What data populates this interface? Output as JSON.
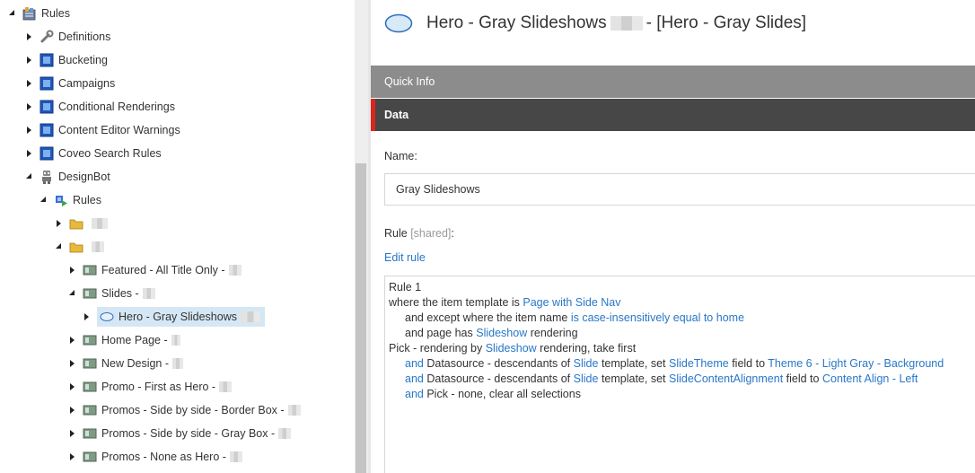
{
  "tree": {
    "rules": "Rules",
    "definitions": "Definitions",
    "bucketing": "Bucketing",
    "campaigns": "Campaigns",
    "conditional_renderings": "Conditional Renderings",
    "content_editor_warnings": "Content Editor Warnings",
    "coveo_search_rules": "Coveo Search Rules",
    "designbot": "DesignBot",
    "designbot_rules": "Rules",
    "featured": "Featured - All Title Only -",
    "slides": "Slides -",
    "hero_selected": "Hero - Gray Slideshows",
    "home_page": "Home Page -",
    "new_design": "New Design -",
    "promo_first": "Promo - First as Hero -",
    "promos_border": "Promos - Side by side - Border Box -",
    "promos_gray": "Promos - Side by side - Gray Box -",
    "promos_none": "Promos - None as Hero -"
  },
  "header": {
    "title_part1": "Hero - Gray Slideshows",
    "title_part2": "- [Hero - Gray Slides]"
  },
  "sections": {
    "quick_info": "Quick Info",
    "data": "Data"
  },
  "fields": {
    "name_label": "Name:",
    "name_value": "Gray Slideshows",
    "rule_label": "Rule",
    "rule_shared": "[shared]",
    "rule_colon": ":",
    "edit_rule": "Edit rule"
  },
  "rule": {
    "l1": "Rule 1",
    "l2a": "where the item template is",
    "l2b": "Page with Side Nav",
    "l3a": "and except where the item name",
    "l3b": "is case-insensitively equal to",
    "l3c": "home",
    "l4a": "and page has",
    "l4b": "Slideshow",
    "l4c": "rendering",
    "l5a": "Pick - rendering by",
    "l5b": "Slideshow",
    "l5c": "rendering, take first",
    "l6a": "and",
    "l6b": "Datasource - descendants of",
    "l6c": "Slide",
    "l6d": "template, set",
    "l6e": "SlideTheme",
    "l6f": "field to",
    "l6g": "Theme 6 - Light Gray - Background",
    "l7a": "and",
    "l7b": "Datasource - descendants of",
    "l7c": "Slide",
    "l7d": "template, set",
    "l7e": "SlideContentAlignment",
    "l7f": "field to",
    "l7g": "Content Align - Left",
    "l8a": "and",
    "l8b": "Pick - none, clear all selections"
  }
}
